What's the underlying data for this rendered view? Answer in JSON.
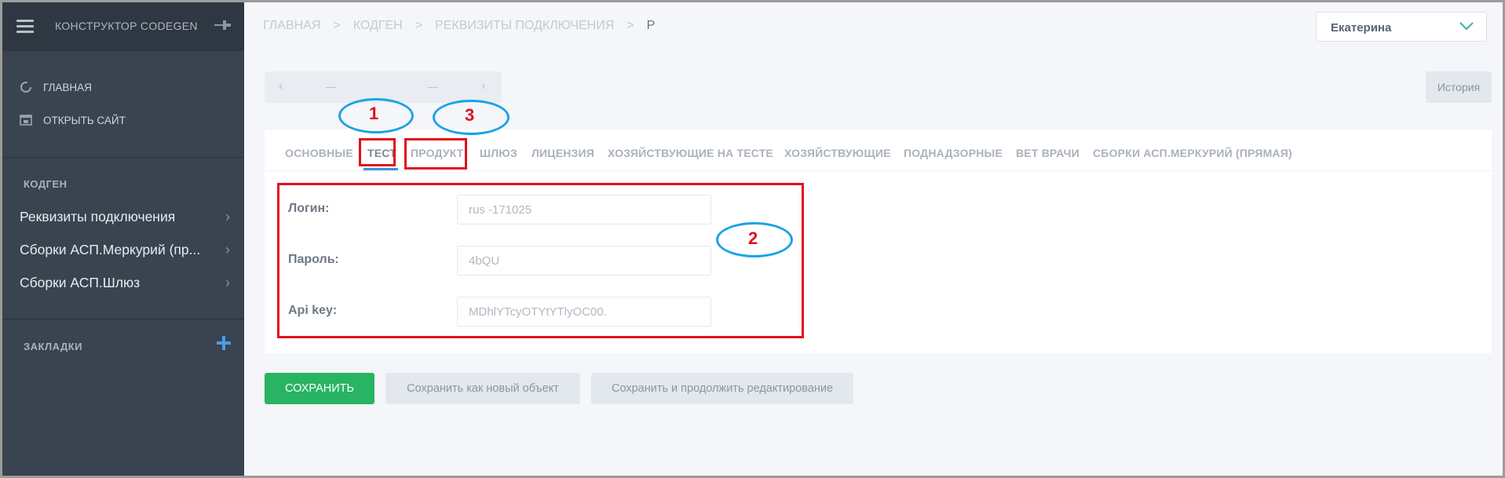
{
  "sidebar": {
    "brand": "КОНСТРУКТОР CODEGEN",
    "links": [
      {
        "label": "ГЛАВНАЯ",
        "icon": "refresh-icon"
      },
      {
        "label": "ОТКРЫТЬ САЙТ",
        "icon": "open-site-icon"
      }
    ],
    "section_title": "КОДГЕН",
    "items": [
      {
        "label": "Реквизиты подключения"
      },
      {
        "label": "Сборки АСП.Меркурий (пр..."
      },
      {
        "label": "Сборки АСП.Шлюз"
      }
    ],
    "bookmarks_title": "ЗАКЛАДКИ"
  },
  "breadcrumb": {
    "items": [
      "ГЛАВНАЯ",
      "КОДГЕН",
      "РЕКВИЗИТЫ ПОДКЛЮЧЕНИЯ"
    ],
    "current": "Р",
    "separator": ">"
  },
  "user": {
    "name": "Екатерина"
  },
  "pager": {
    "prev": "‹",
    "next": "›",
    "left_value": "—",
    "right_value": "—"
  },
  "history_label": "История",
  "tabs": [
    {
      "label": "ОСНОВНЫЕ"
    },
    {
      "label": "ТЕСТ",
      "active": true
    },
    {
      "label": "ПРОДУКТ"
    },
    {
      "label": "ШЛЮЗ"
    },
    {
      "label": "ЛИЦЕНЗИЯ"
    },
    {
      "label": "ХОЗЯЙСТВУЮЩИЕ НА ТЕСТЕ"
    },
    {
      "label": "ХОЗЯЙСТВУЮЩИЕ"
    },
    {
      "label": "ПОДНАДЗОРНЫЕ"
    },
    {
      "label": "ВЕТ ВРАЧИ"
    },
    {
      "label": "СБОРКИ АСП.МЕРКУРИЙ (ПРЯМАЯ)"
    }
  ],
  "form": {
    "fields": [
      {
        "label": "Логин:",
        "value": "rus -171025"
      },
      {
        "label": "Пароль:",
        "value": "4bQU"
      },
      {
        "label": "Api key:",
        "value": "MDhlYTcyOTYtYTlyOC00."
      }
    ]
  },
  "buttons": {
    "save": "СОХРАНИТЬ",
    "save_new": "Сохранить как новый объект",
    "save_continue": "Сохранить и продолжить редактирование"
  },
  "annotations": {
    "n1": "1",
    "n2": "2",
    "n3": "3"
  },
  "colors": {
    "accent": "#3a95e0",
    "save": "#28b463",
    "annotation_red": "#e0101e",
    "annotation_blue": "#1aa3e6"
  }
}
